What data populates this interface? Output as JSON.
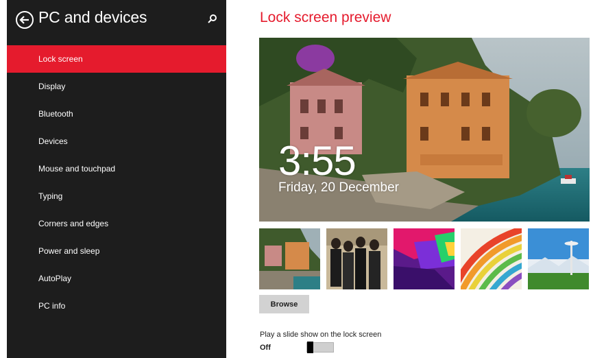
{
  "sidebar": {
    "title": "PC and devices",
    "back_icon": "back-arrow-icon",
    "search_icon": "search-icon",
    "background": "#1d1d1d",
    "active_color": "#e51b2d",
    "items": [
      {
        "label": "Lock screen",
        "active": true
      },
      {
        "label": "Display"
      },
      {
        "label": "Bluetooth"
      },
      {
        "label": "Devices"
      },
      {
        "label": "Mouse and touchpad"
      },
      {
        "label": "Typing"
      },
      {
        "label": "Corners and edges"
      },
      {
        "label": "Power and sleep"
      },
      {
        "label": "AutoPlay"
      },
      {
        "label": "PC info"
      }
    ]
  },
  "main": {
    "title": "Lock screen preview",
    "title_color": "#e51b2d",
    "preview": {
      "time": "3:55",
      "date": "Friday, 20 December"
    },
    "thumbnails": [
      {
        "name": "coastal-villas"
      },
      {
        "name": "band-photo"
      },
      {
        "name": "geometric-colors"
      },
      {
        "name": "rainbow-stripes"
      },
      {
        "name": "space-needle"
      }
    ],
    "browse_label": "Browse",
    "slideshow": {
      "label": "Play a slide show on the lock screen",
      "state": "Off"
    }
  }
}
